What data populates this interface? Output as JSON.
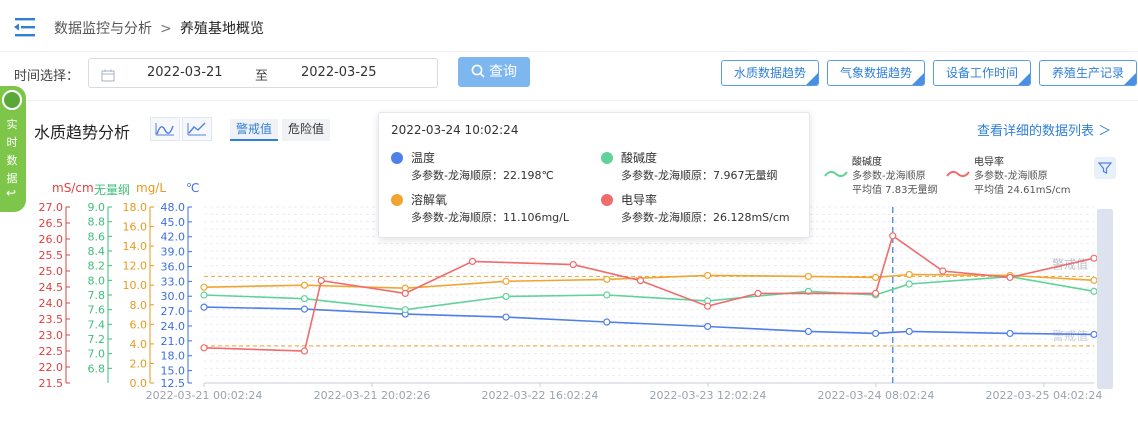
{
  "breadcrumb": {
    "level1": "数据监控与分析",
    "sep": ">",
    "level2": "养殖基地概览"
  },
  "filter": {
    "label": "时间选择：",
    "start": "2022-03-21",
    "to": "至",
    "end": "2022-03-25",
    "query": "查询"
  },
  "nav_tabs": [
    "水质数据趋势",
    "气象数据趋势",
    "设备工作时间",
    "养殖生产记录"
  ],
  "realtime_tab": "实时数据",
  "panel": {
    "title": "水质趋势分析",
    "toggle_warn": "警戒值",
    "toggle_danger": "危险值",
    "more": "查看详细的数据列表 ＞"
  },
  "units": {
    "conductivity": "mS/cm",
    "ph": "无量纲",
    "oxygen": "mg/L",
    "temperature": "℃"
  },
  "tooltip": {
    "time": "2022-03-24 10:02:24",
    "items": [
      {
        "name": "温度",
        "value": "多参数-龙海顺原：22.198℃",
        "color": "#4f7fe8"
      },
      {
        "name": "酸碱度",
        "value": "多参数-龙海顺原：7.967无量纲",
        "color": "#5fd39a"
      },
      {
        "name": "溶解氧",
        "value": "多参数-龙海顺原：11.106mg/L",
        "color": "#f0a530"
      },
      {
        "name": "电导率",
        "value": "多参数-龙海顺原：26.128mS/cm",
        "color": "#f06b6b"
      }
    ]
  },
  "legend": [
    {
      "name": "酸碱度",
      "sub1": "多参数-龙海顺原",
      "sub2": "平均值 7.83无量纲",
      "color": "#5fd39a"
    },
    {
      "name": "电导率",
      "sub1": "多参数-龙海顺原",
      "sub2": "平均值 24.61mS/cm",
      "color": "#f06b6b"
    }
  ],
  "threshold_labels": {
    "warn": "警戒值",
    "danger": "警戒值"
  },
  "colors": {
    "temperature": "#4f7fe8",
    "ph": "#5fd39a",
    "oxygen": "#f0a530",
    "conductivity": "#f06b6b",
    "accent": "#2f7fd8"
  },
  "chart_data": {
    "type": "line",
    "x_ticks": [
      "2022-03-21 00:02:24",
      "2022-03-21 20:02:26",
      "2022-03-22 16:02:24",
      "2022-03-23 12:02:24",
      "2022-03-24 08:02:24",
      "2022-03-25 04:02:24"
    ],
    "x_start": "2022-03-21 00:02:24",
    "x_end": "2022-03-25 10:00:00",
    "cursor_time": "2022-03-24 10:02:24",
    "axes": [
      {
        "id": "conductivity",
        "unit": "mS/cm",
        "min": 21.5,
        "max": 27.0,
        "ticks": [
          "27.0",
          "26.5",
          "26.0",
          "25.5",
          "25.0",
          "24.5",
          "24.0",
          "23.5",
          "23.0",
          "22.5",
          "22.0",
          "21.5"
        ]
      },
      {
        "id": "ph",
        "unit": "无量纲",
        "min": 6.6,
        "max": 9.0,
        "ticks": [
          "9.0",
          "8.8",
          "8.6",
          "8.4",
          "8.2",
          "8.0",
          "7.8",
          "7.6",
          "7.4",
          "7.2",
          "7.0",
          "6.8"
        ]
      },
      {
        "id": "oxygen",
        "unit": "mg/L",
        "min": 0.0,
        "max": 18.0,
        "ticks": [
          "18.0",
          "16.0",
          "14.0",
          "12.0",
          "10.0",
          "8.0",
          "6.0",
          "4.0",
          "2.0",
          "0.0"
        ]
      },
      {
        "id": "temperature",
        "unit": "℃",
        "min": 12.5,
        "max": 48.0,
        "ticks": [
          "48.0",
          "45.0",
          "42.0",
          "39.0",
          "36.0",
          "33.0",
          "30.0",
          "27.0",
          "24.0",
          "21.0",
          "18.0",
          "15.0",
          "12.5"
        ]
      }
    ],
    "thresholds": {
      "warn_temperature": 34.0,
      "danger_temperature": 20.0
    },
    "series": [
      {
        "name": "温度",
        "axis": "temperature",
        "points": [
          [
            "2022-03-21 00:02:24",
            27.8
          ],
          [
            "2022-03-21 12:00:00",
            27.4
          ],
          [
            "2022-03-22 00:00:00",
            26.4
          ],
          [
            "2022-03-22 12:00:00",
            25.8
          ],
          [
            "2022-03-23 00:00:00",
            24.8
          ],
          [
            "2022-03-23 12:00:00",
            23.9
          ],
          [
            "2022-03-24 00:00:00",
            22.9
          ],
          [
            "2022-03-24 08:00:00",
            22.5
          ],
          [
            "2022-03-24 12:00:00",
            22.9
          ],
          [
            "2022-03-25 00:00:00",
            22.5
          ],
          [
            "2022-03-25 10:00:00",
            22.3
          ]
        ]
      },
      {
        "name": "酸碱度",
        "axis": "ph",
        "points": [
          [
            "2022-03-21 00:02:24",
            7.8
          ],
          [
            "2022-03-21 12:00:00",
            7.75
          ],
          [
            "2022-03-22 00:00:00",
            7.6
          ],
          [
            "2022-03-22 12:00:00",
            7.78
          ],
          [
            "2022-03-23 00:00:00",
            7.8
          ],
          [
            "2022-03-23 12:00:00",
            7.72
          ],
          [
            "2022-03-24 00:00:00",
            7.85
          ],
          [
            "2022-03-24 08:00:00",
            7.8
          ],
          [
            "2022-03-24 12:00:00",
            7.95
          ],
          [
            "2022-03-25 00:00:00",
            8.05
          ],
          [
            "2022-03-25 10:00:00",
            7.85
          ]
        ]
      },
      {
        "name": "溶解氧",
        "axis": "oxygen",
        "points": [
          [
            "2022-03-21 00:02:24",
            9.8
          ],
          [
            "2022-03-21 12:00:00",
            10.0
          ],
          [
            "2022-03-22 00:00:00",
            9.7
          ],
          [
            "2022-03-22 12:00:00",
            10.4
          ],
          [
            "2022-03-23 00:00:00",
            10.6
          ],
          [
            "2022-03-23 12:00:00",
            11.0
          ],
          [
            "2022-03-24 00:00:00",
            10.9
          ],
          [
            "2022-03-24 08:00:00",
            10.8
          ],
          [
            "2022-03-24 12:00:00",
            11.1
          ],
          [
            "2022-03-25 00:00:00",
            11.0
          ],
          [
            "2022-03-25 10:00:00",
            10.5
          ]
        ]
      },
      {
        "name": "电导率",
        "axis": "conductivity",
        "points": [
          [
            "2022-03-21 00:02:24",
            22.6
          ],
          [
            "2022-03-21 12:00:00",
            22.5
          ],
          [
            "2022-03-21 14:00:00",
            24.7
          ],
          [
            "2022-03-22 00:00:00",
            24.3
          ],
          [
            "2022-03-22 08:00:00",
            25.3
          ],
          [
            "2022-03-22 20:00:00",
            25.2
          ],
          [
            "2022-03-23 04:00:00",
            24.7
          ],
          [
            "2022-03-23 12:00:00",
            23.9
          ],
          [
            "2022-03-23 18:00:00",
            24.3
          ],
          [
            "2022-03-24 08:00:00",
            24.3
          ],
          [
            "2022-03-24 10:02:24",
            26.1
          ],
          [
            "2022-03-24 16:00:00",
            25.0
          ],
          [
            "2022-03-25 00:00:00",
            24.8
          ],
          [
            "2022-03-25 10:00:00",
            25.4
          ]
        ]
      }
    ]
  }
}
